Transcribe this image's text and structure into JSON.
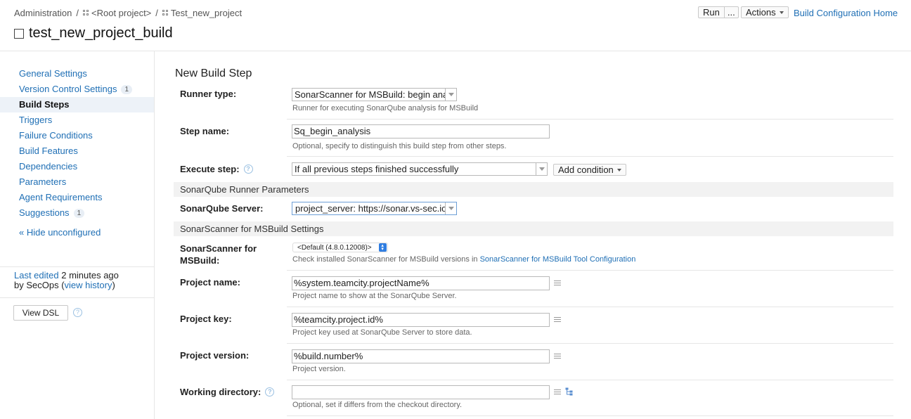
{
  "breadcrumb": {
    "admin": "Administration",
    "sep1": "/",
    "root": "<Root project>",
    "sep2": "/",
    "project": "Test_new_project"
  },
  "page_title": "test_new_project_build",
  "toolbar": {
    "run_label": "Run",
    "run_more_label": "...",
    "actions_label": "Actions",
    "home_link": "Build Configuration Home"
  },
  "sidebar": {
    "items": [
      {
        "label": "General Settings",
        "count": ""
      },
      {
        "label": "Version Control Settings",
        "count": "1"
      },
      {
        "label": "Build Steps",
        "count": ""
      },
      {
        "label": "Triggers",
        "count": ""
      },
      {
        "label": "Failure Conditions",
        "count": ""
      },
      {
        "label": "Build Features",
        "count": ""
      },
      {
        "label": "Dependencies",
        "count": ""
      },
      {
        "label": "Parameters",
        "count": ""
      },
      {
        "label": "Agent Requirements",
        "count": ""
      },
      {
        "label": "Suggestions",
        "count": "1"
      }
    ],
    "hide_unconfigured": "« Hide unconfigured",
    "last_edited_link": "Last edited",
    "last_edited_time": "2 minutes ago",
    "by_label": "by SecOps",
    "view_history": "view history",
    "view_dsl": "View DSL"
  },
  "form": {
    "title": "New Build Step",
    "runner_type": {
      "label": "Runner type:",
      "value": "SonarScanner for MSBuild: begin analysis",
      "hint": "Runner for executing SonarQube analysis for MSBuild"
    },
    "step_name": {
      "label": "Step name:",
      "value": "Sq_begin_analysis",
      "hint": "Optional, specify to distinguish this build step from other steps."
    },
    "execute_step": {
      "label": "Execute step:",
      "value": "If all previous steps finished successfully",
      "add_condition": "Add condition"
    },
    "sonarqube_group": "SonarQube Runner Parameters",
    "sonarqube_server": {
      "label": "SonarQube Server:",
      "value": "project_server: https://sonar.vs-sec.io"
    },
    "msbuild_group": "SonarScanner for MSBuild Settings",
    "scanner": {
      "label_line1": "SonarScanner for",
      "label_line2": "MSBuild:",
      "value": "<Default (4.8.0.12008)>",
      "hint_prefix": "Check installed SonarScanner for MSBuild versions in",
      "hint_link": "SonarScanner for MSBuild Tool Configuration"
    },
    "project_name": {
      "label": "Project name:",
      "value": "%system.teamcity.projectName%",
      "hint": "Project name to show at the SonarQube Server."
    },
    "project_key": {
      "label": "Project key:",
      "value": "%teamcity.project.id%",
      "hint": "Project key used at SonarQube Server to store data."
    },
    "project_version": {
      "label": "Project version:",
      "value": "%build.number%",
      "hint": "Project version."
    },
    "working_dir": {
      "label": "Working directory:",
      "value": "",
      "hint": "Optional, set if differs from the checkout directory."
    }
  },
  "colors": {
    "link": "#1f6fb5",
    "active_nav_bg": "#edf2f8",
    "group_header_bg": "#f2f2f2",
    "stepper_blue": "#2f7de1"
  }
}
